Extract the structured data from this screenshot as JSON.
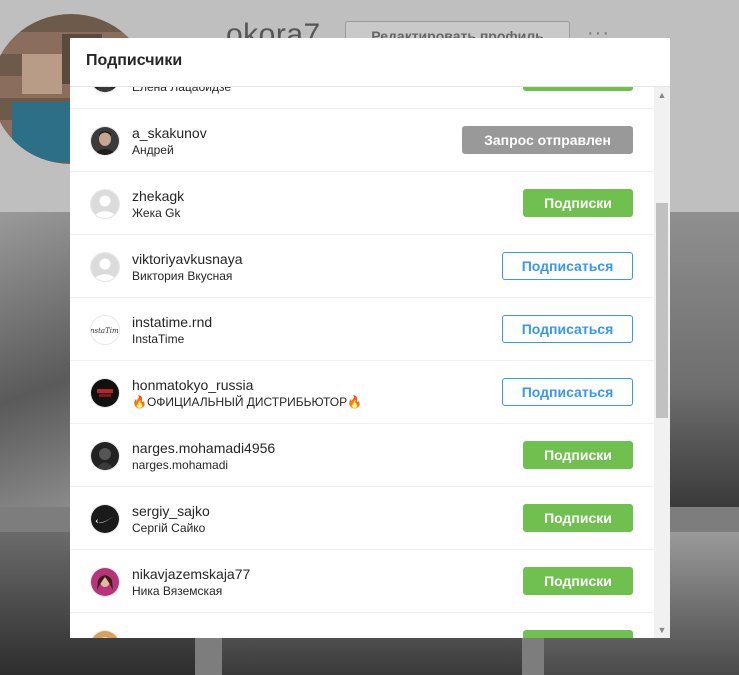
{
  "background": {
    "username": "okora7",
    "edit_profile_label": "Редактировать профиль",
    "more_label": "···"
  },
  "modal": {
    "title": "Подписчики"
  },
  "followers": [
    {
      "username": "",
      "name": "Елена Лацабидзе",
      "button": "Подписки",
      "state": "following",
      "avatar": "dark-photo"
    },
    {
      "username": "a_skakunov",
      "name": "Андрей",
      "button": "Запрос отправлен",
      "state": "requested",
      "avatar": "man-photo"
    },
    {
      "username": "zhekagk",
      "name": "Жека Gk",
      "button": "Подписки",
      "state": "following",
      "avatar": "default"
    },
    {
      "username": "viktoriyavkusnaya",
      "name": "Виктория Вкусная",
      "button": "Подписаться",
      "state": "follow",
      "avatar": "default"
    },
    {
      "username": "instatime.rnd",
      "name": "InstaTime",
      "button": "Подписаться",
      "state": "follow",
      "avatar": "instatime-logo"
    },
    {
      "username": "honmatokyo_russia",
      "name": "🔥ОФИЦИАЛЬНЫЙ ДИСТРИБЬЮТОР🔥",
      "button": "Подписаться",
      "state": "follow",
      "avatar": "honma-logo"
    },
    {
      "username": "narges.mohamadi4956",
      "name": "narges.mohamadi",
      "button": "Подписки",
      "state": "following",
      "avatar": "dark-photo"
    },
    {
      "username": "sergiy_sajko",
      "name": "Сергій Сайко",
      "button": "Подписки",
      "state": "following",
      "avatar": "nike-logo"
    },
    {
      "username": "nikavjazemskaja77",
      "name": "Ника Вяземская",
      "button": "Подписки",
      "state": "following",
      "avatar": "woman-photo"
    },
    {
      "username": "",
      "name": "",
      "button": "",
      "state": "following",
      "avatar": "partial"
    }
  ],
  "colors": {
    "following_green": "#70c050",
    "follow_blue": "#3897f0",
    "requested_gray": "#999999"
  },
  "icons": {
    "scroll_up": "▲",
    "scroll_down": "▼"
  }
}
